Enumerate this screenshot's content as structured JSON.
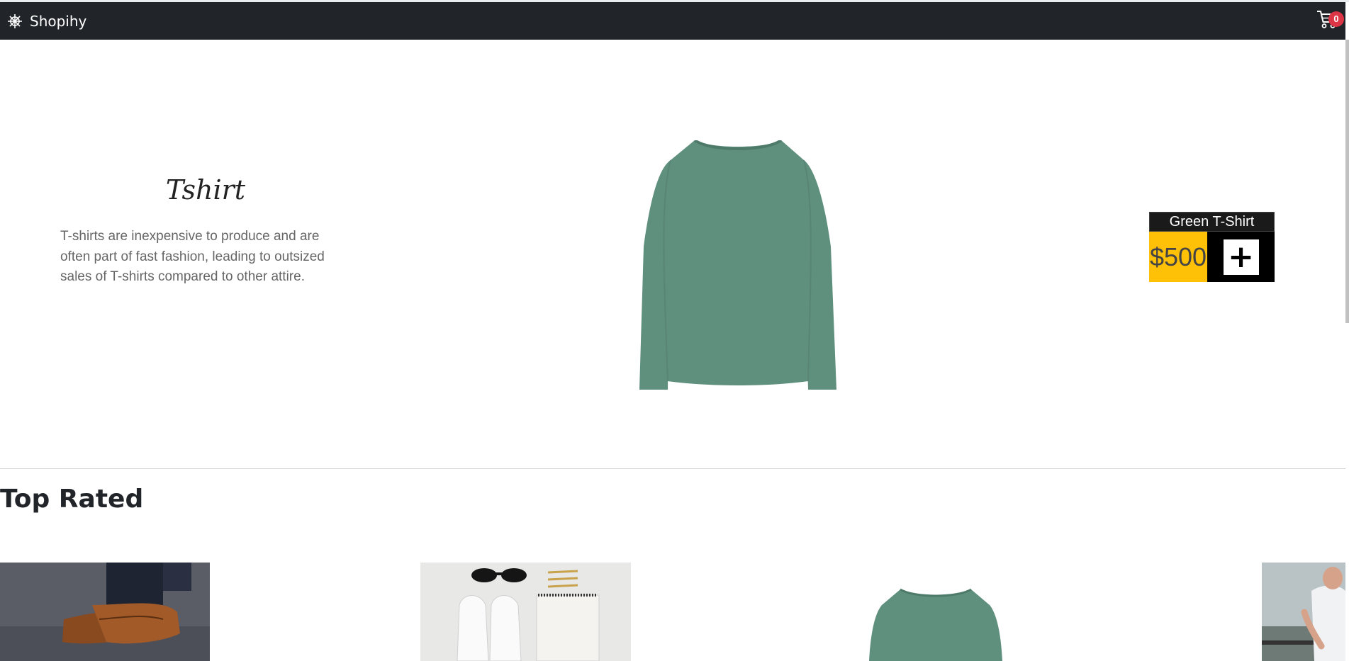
{
  "navbar": {
    "brand_icon": "ship-wheel-icon",
    "brand_name": "Shopihy",
    "cart_icon": "cart-icon",
    "cart_count": "0",
    "background": "#212529",
    "badge_color": "#dc3545"
  },
  "hero": {
    "title": "Tshirt",
    "description": "T-shirts are inexpensive to produce and are often part of fast fashion, leading to outsized sales of T-shirts compared to other attire.",
    "product": {
      "name": "Green T-Shirt",
      "price": "$500",
      "add_label": "+",
      "price_bg": "#ffc107",
      "shirt_color": "#5f8f7d"
    }
  },
  "top_rated": {
    "title": "Top Rated",
    "items": [
      {
        "image": "brown-shoes-photo"
      },
      {
        "image": "white-sneakers-flatlay-photo"
      },
      {
        "image": "green-tshirt-photo"
      },
      {
        "image": "man-outdoor-photo"
      }
    ]
  }
}
